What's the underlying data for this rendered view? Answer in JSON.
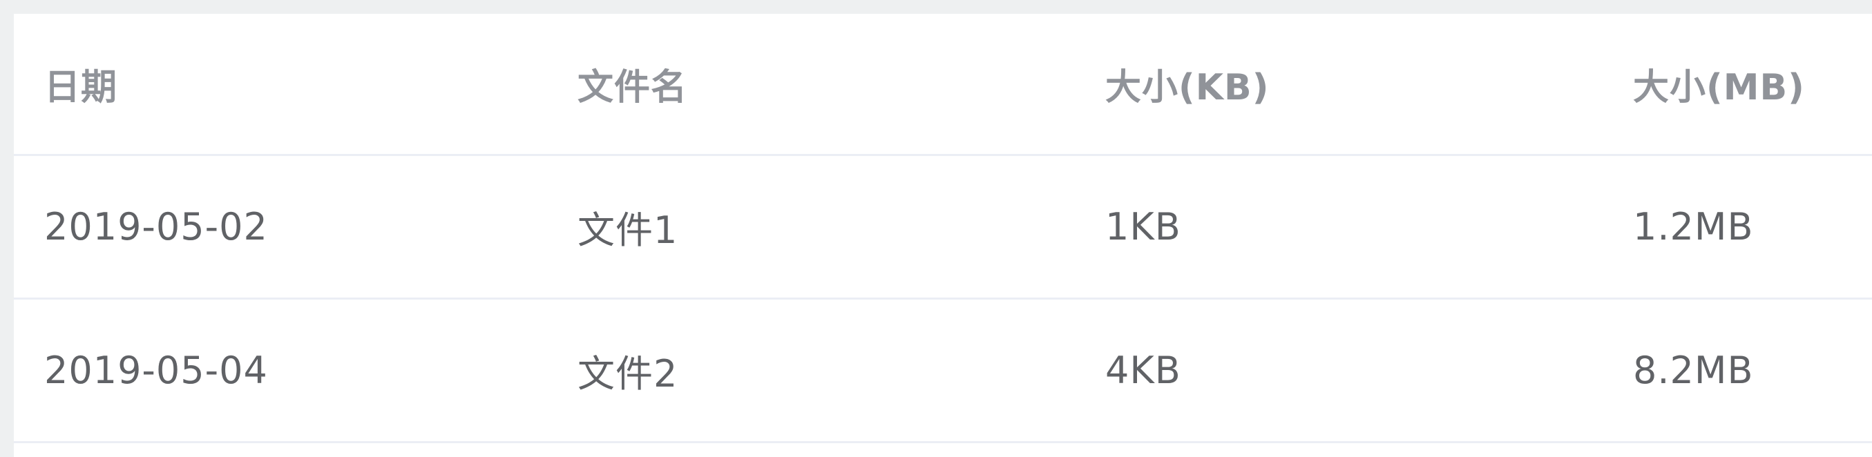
{
  "table": {
    "columns": [
      "日期",
      "文件名",
      "大小(KB)",
      "大小(MB)"
    ],
    "rows": [
      [
        "2019-05-02",
        "文件1",
        "1KB",
        "1.2MB"
      ],
      [
        "2019-05-04",
        "文件2",
        "4KB",
        "8.2MB"
      ]
    ]
  }
}
